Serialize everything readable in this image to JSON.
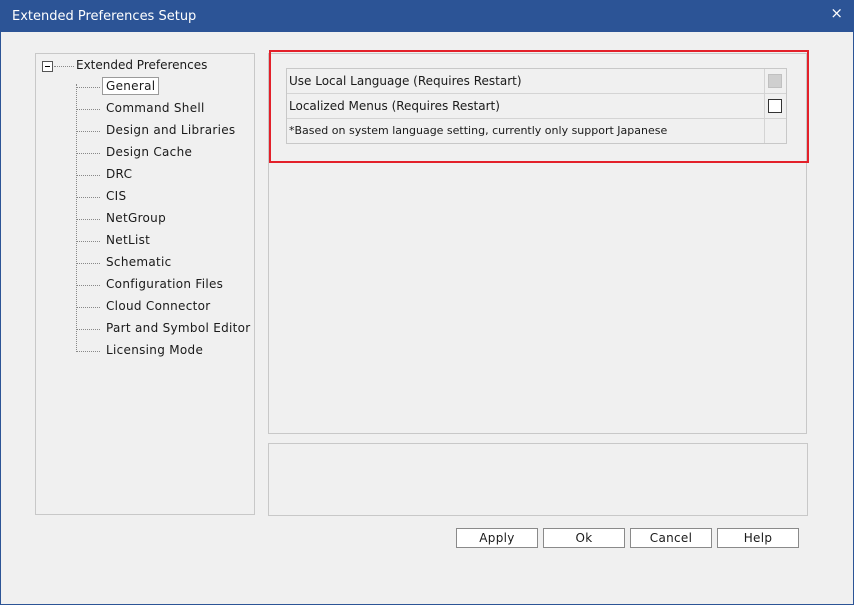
{
  "window": {
    "title": "Extended Preferences Setup",
    "close_glyph": "×"
  },
  "tree": {
    "root_label": "Extended Preferences",
    "items": [
      {
        "label": "General",
        "selected": true
      },
      {
        "label": "Command Shell"
      },
      {
        "label": "Design and Libraries"
      },
      {
        "label": "Design Cache"
      },
      {
        "label": "DRC"
      },
      {
        "label": "CIS"
      },
      {
        "label": "NetGroup"
      },
      {
        "label": "NetList"
      },
      {
        "label": "Schematic"
      },
      {
        "label": "Configuration Files"
      },
      {
        "label": "Cloud Connector"
      },
      {
        "label": "Part and Symbol Editor"
      },
      {
        "label": "Licensing Mode"
      }
    ]
  },
  "settings": {
    "rows": [
      {
        "label": "Use Local Language (Requires Restart)",
        "checkbox": "disabled",
        "checked": false
      },
      {
        "label": "Localized Menus (Requires Restart)",
        "checkbox": "enabled",
        "checked": false
      },
      {
        "label": "*Based on system language setting, currently only support Japanese"
      }
    ]
  },
  "buttons": {
    "apply": "Apply",
    "ok": "Ok",
    "cancel": "Cancel",
    "help": "Help"
  },
  "colors": {
    "titlebar": "#2c5496",
    "highlight": "#e3202a"
  }
}
